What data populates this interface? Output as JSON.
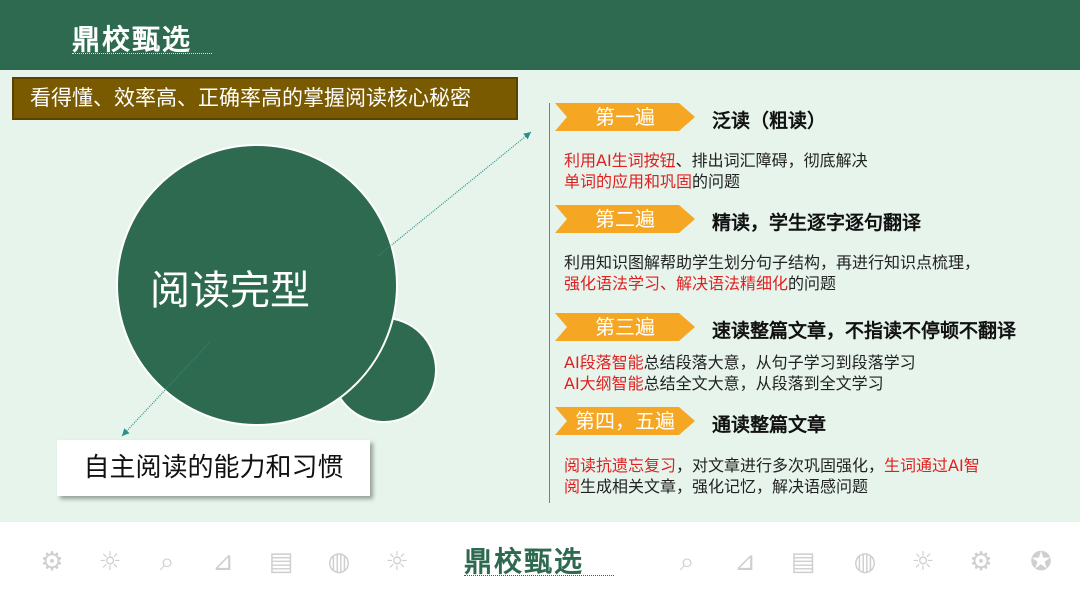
{
  "brand": {
    "logo": "鼎校甄选"
  },
  "headline": "看得懂、效率高、正确率高的掌握阅读核心秘密",
  "core": "阅读完型",
  "goal": "自主阅读的能力和习惯",
  "steps": [
    {
      "tab": "第一遍",
      "title": "泛读（粗读）",
      "desc": [
        {
          "t": "利用AI生词按钮",
          "red": true
        },
        {
          "t": "、排出词汇障碍，彻底解决",
          "red": false
        },
        {
          "t": "单词的应用和巩固",
          "red": true
        },
        {
          "t": "的问题",
          "red": false
        }
      ]
    },
    {
      "tab": "第二遍",
      "title": "精读，学生逐字逐句翻译",
      "desc": [
        {
          "t": "利用知识图解帮助学生划分句子结构，再进行知识点梳理，",
          "red": false
        },
        {
          "t": "强化语法学习、解决语法精细化",
          "red": true
        },
        {
          "t": "的问题",
          "red": false
        }
      ]
    },
    {
      "tab": "第三遍",
      "title": "速读整篇文章，不指读不停顿不翻译",
      "desc": [
        {
          "t": "AI段落智能",
          "red": true
        },
        {
          "t": "总结段落大意，从句子学习到段落学习",
          "red": false
        },
        {
          "t": "\nAI大纲智能",
          "red": true
        },
        {
          "t": "总结全文大意，从段落到全文学习",
          "red": false
        }
      ]
    },
    {
      "tab": "第四，五遍",
      "title": "通读整篇文章",
      "desc": [
        {
          "t": "阅读抗遗忘复习",
          "red": true
        },
        {
          "t": "，对文章进行多次巩固强化，",
          "red": false
        },
        {
          "t": "生词通过AI智阅",
          "red": true
        },
        {
          "t": "生成相关文章，强化记忆，解决语感问题",
          "red": false
        }
      ]
    }
  ],
  "footer": {
    "logo": "鼎校甄选",
    "icons": [
      "medal-icon",
      "bulb-icon",
      "search-icon",
      "tools-icon",
      "document-icon",
      "globe-icon",
      "bulb-icon",
      "search-icon",
      "tools-icon",
      "document-icon",
      "globe-icon",
      "bulb-icon",
      "gears-icon",
      "medal-icon"
    ]
  },
  "colors": {
    "brand_green": "#2d6a4f",
    "headline_bg": "#7a5a00",
    "tab_orange": "#f5a623",
    "accent_red": "#e02020"
  }
}
